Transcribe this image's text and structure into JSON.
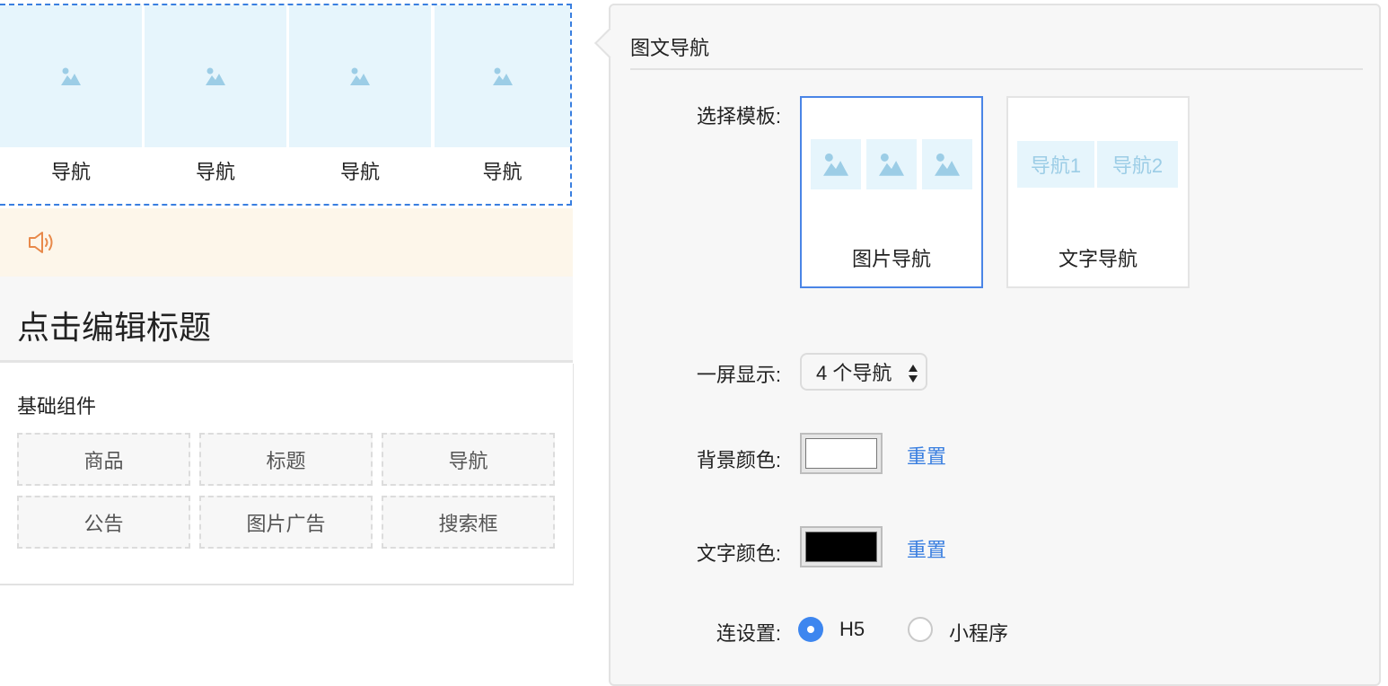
{
  "preview": {
    "nav_items": [
      {
        "label": "导航"
      },
      {
        "label": "导航"
      },
      {
        "label": "导航"
      },
      {
        "label": "导航"
      }
    ],
    "notice_icon": "speaker-icon",
    "title": "点击编辑标题",
    "components_title": "基础组件",
    "components": [
      {
        "label": "商品"
      },
      {
        "label": "标题"
      },
      {
        "label": "导航"
      },
      {
        "label": "公告"
      },
      {
        "label": "图片广告"
      },
      {
        "label": "搜索框"
      }
    ]
  },
  "panel": {
    "title": "图文导航",
    "template_label": "选择模板:",
    "templates": [
      {
        "name": "图片导航",
        "selected": true
      },
      {
        "name": "文字导航",
        "selected": false,
        "samples": [
          "导航1",
          "导航2"
        ]
      }
    ],
    "per_screen_label": "一屏显示:",
    "per_screen_value": "4 个导航",
    "bg_color_label": "背景颜色:",
    "bg_color": "#ffffff",
    "text_color_label": "文字颜色:",
    "text_color": "#000000",
    "reset_label": "重置",
    "link_label": "连设置:",
    "link_options": [
      {
        "label": "H5",
        "checked": true
      },
      {
        "label": "小程序",
        "checked": false
      }
    ]
  },
  "colors": {
    "accent": "#3a7fe0",
    "image_placeholder_bg": "#e6f5fc",
    "image_placeholder_icon": "#9ccde6",
    "notice_bg": "#fdf6ea",
    "notice_icon": "#e8894a"
  }
}
